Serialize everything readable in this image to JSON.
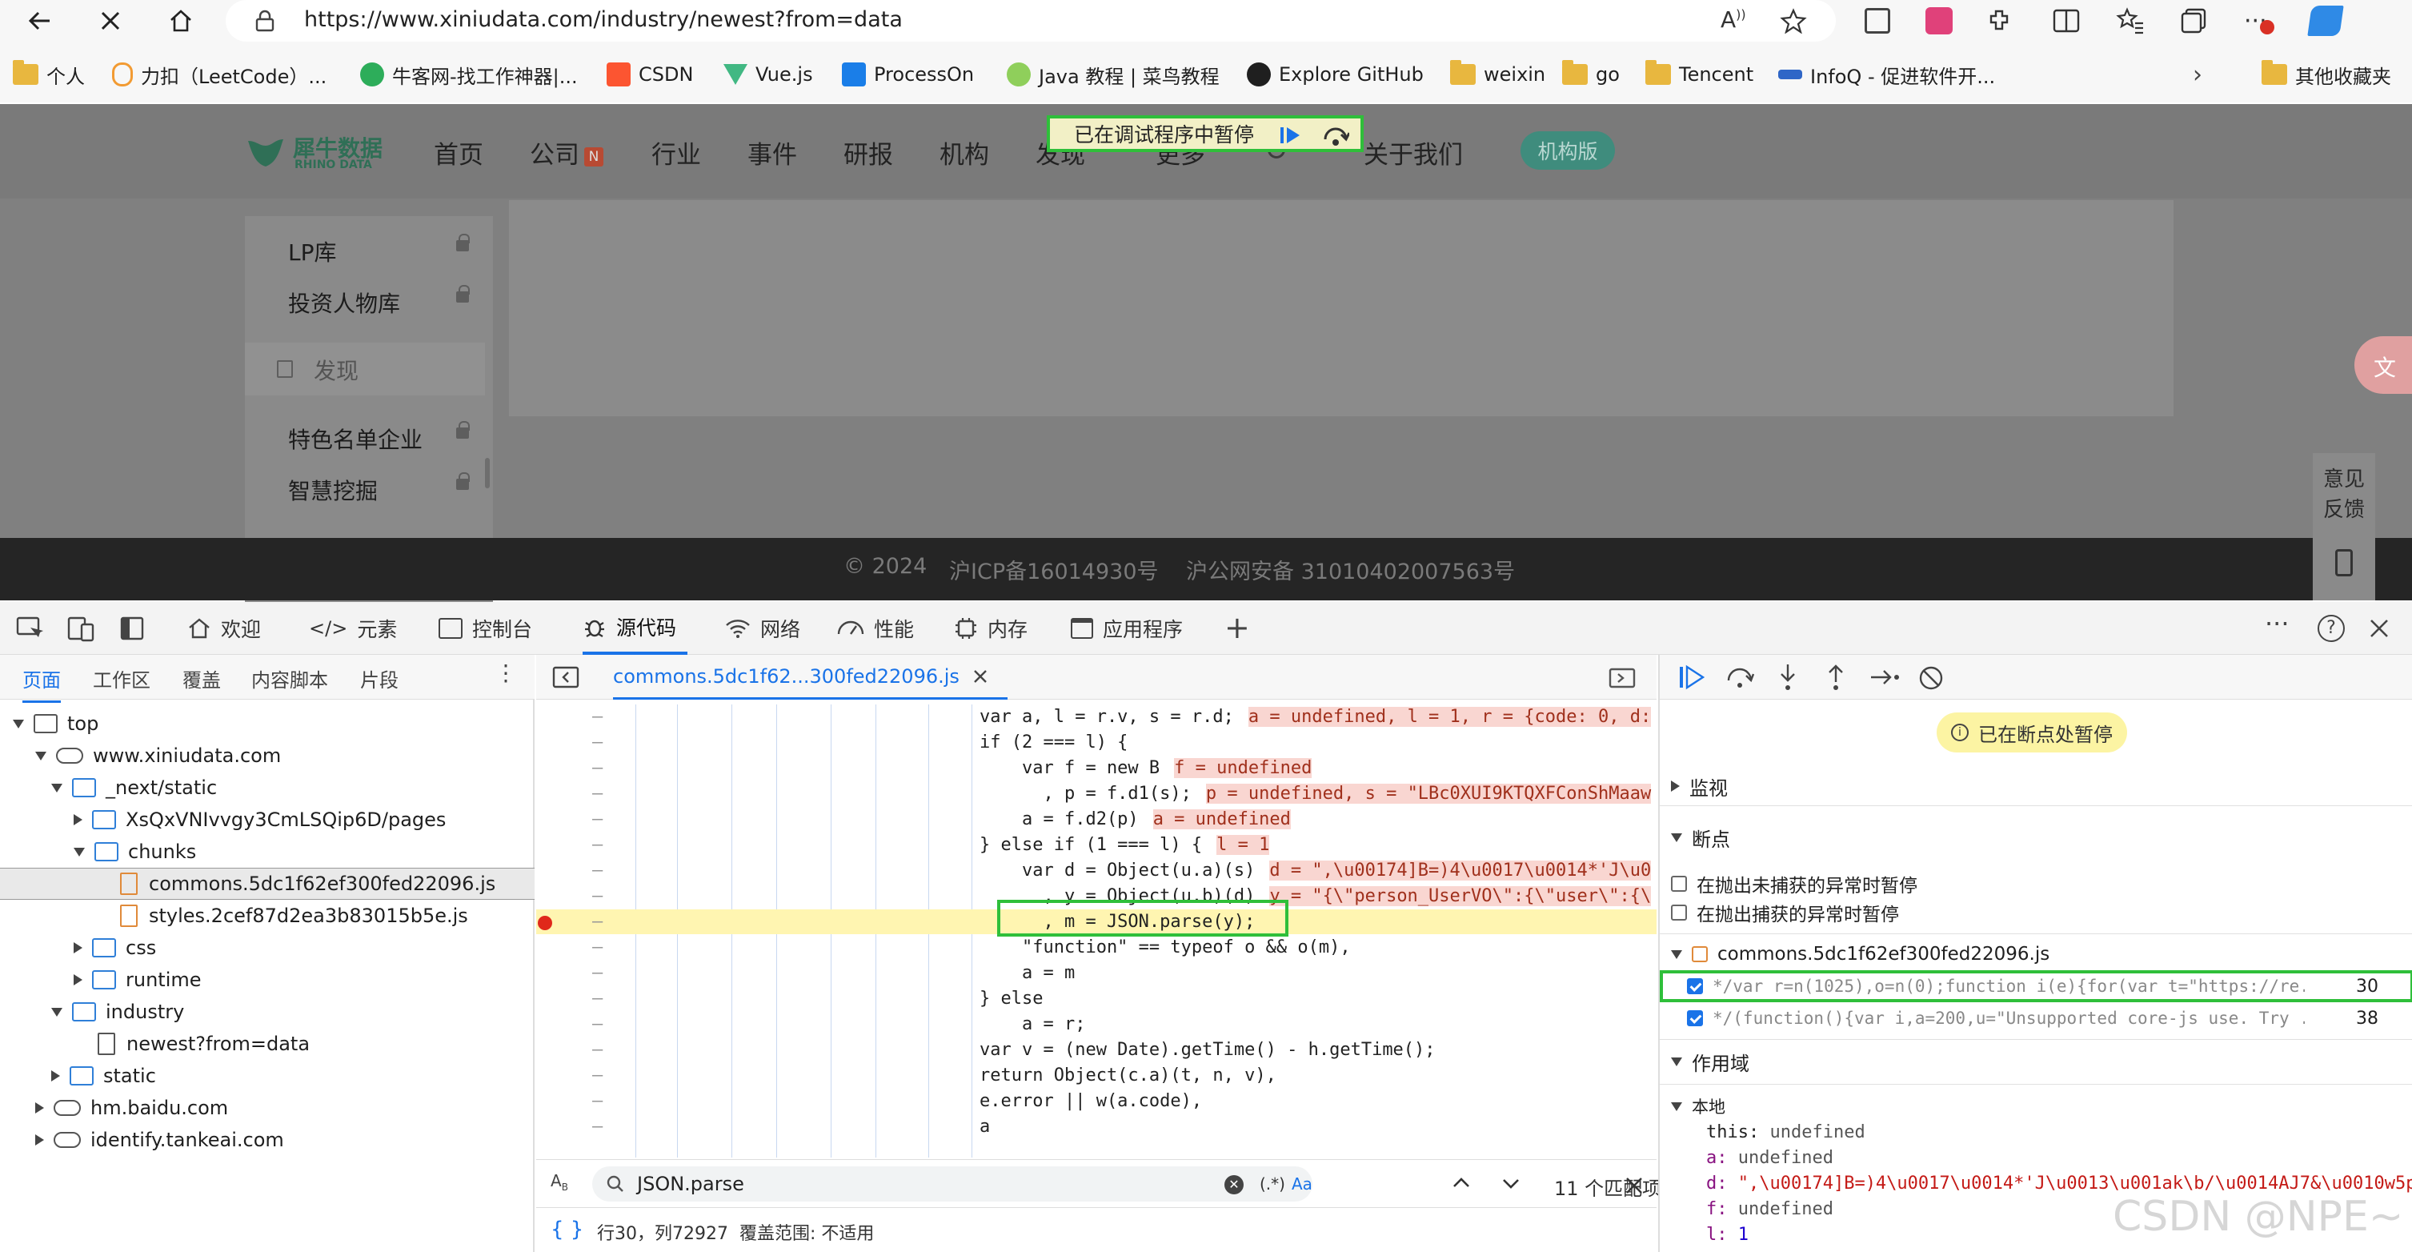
{
  "browser": {
    "url": "https://www.xiniudata.com/industry/newest?from=data",
    "bookmarks": [
      "个人",
      "力扣（LeetCode）...",
      "牛客网-找工作神器|...",
      "CSDN",
      "Vue.js",
      "ProcessOn",
      "Java 教程 | 菜鸟教程",
      "Explore GitHub",
      "weixin",
      "go",
      "Tencent",
      "InfoQ - 促进软件开..."
    ],
    "other_bookmarks": "其他收藏夹"
  },
  "site": {
    "logo_main": "犀牛数据",
    "logo_sub": "RHINO DATA",
    "nav": [
      "首页",
      "公司",
      "行业",
      "事件",
      "研报",
      "机构",
      "发现",
      "更多",
      "关于我们"
    ],
    "nav_badge": "N",
    "org_button": "机构版",
    "debug_banner": "已在调试程序中暂停",
    "menu": [
      "LP库",
      "投资人物库",
      "发现",
      "特色名单企业",
      "智慧挖掘"
    ],
    "footer": [
      "© 2024",
      "沪ICP备16014930号",
      "沪公网安备 31010402007563号"
    ],
    "feedback": [
      "意见",
      "反馈"
    ]
  },
  "devtools": {
    "tabs": [
      "欢迎",
      "元素",
      "控制台",
      "源代码",
      "网络",
      "性能",
      "内存",
      "应用程序"
    ],
    "left_tabs": [
      "页面",
      "工作区",
      "覆盖",
      "内容脚本",
      "片段"
    ],
    "tree": [
      "top",
      "www.xiniudata.com",
      "_next/static",
      "XsQxVNIvvgy3CmLSQip6D/pages",
      "chunks",
      "commons.5dc1f62ef300fed22096.js",
      "styles.2cef87d2ea3b83015b5e.js",
      "css",
      "runtime",
      "industry",
      "newest?from=data",
      "static",
      "hm.baidu.com",
      "identify.tankeai.com"
    ],
    "file_tab": "commons.5dc1f62...300fed22096.js",
    "code": [
      {
        "t": "var a, l = r.v, s = r.d;",
        "i": "a = undefined, l = 1, r = {code: 0, d:"
      },
      {
        "t": "if (2 === l) {",
        "i": ""
      },
      {
        "t": "    var f = new B",
        "i": "f = undefined"
      },
      {
        "t": "      , p = f.d1(s);",
        "i": "p = undefined, s = \"LBc0XUI9KTQXFConShMaaw"
      },
      {
        "t": "    a = f.d2(p)",
        "i": "a = undefined"
      },
      {
        "t": "} else if (1 === l) {",
        "i": "l = 1"
      },
      {
        "t": "    var d = Object(u.a)(s)",
        "i": "d = \",\\u00174]B=)4\\u0017\\u0014*'J\\u0"
      },
      {
        "t": "      , y = Object(u.b)(d)",
        "i": "y = \"{\\\"person_UserVO\\\":{\\\"user\\\":{\\"
      },
      {
        "t": "      , m = JSON.parse(y);",
        "i": ""
      },
      {
        "t": "    \"function\" == typeof o && o(m),",
        "i": ""
      },
      {
        "t": "    a = m",
        "i": ""
      },
      {
        "t": "} else",
        "i": ""
      },
      {
        "t": "    a = r;",
        "i": ""
      },
      {
        "t": "var v = (new Date).getTime() - h.getTime();",
        "i": ""
      },
      {
        "t": "return Object(c.a)(t, n, v),",
        "i": ""
      },
      {
        "t": "e.error || w(a.code),",
        "i": ""
      },
      {
        "t": "a",
        "i": ""
      }
    ],
    "search_value": "JSON.parse",
    "search_regex": "(.*)",
    "search_case": "Aa",
    "match_count": "11 个匹配项",
    "status_pos": "行30，列72927",
    "status_cov": "覆盖范围: 不适用",
    "paused": "已在断点处暂停",
    "sections": {
      "watch": "监视",
      "breakpoints": "断点",
      "scope": "作用域",
      "local": "本地"
    },
    "exc_uncaught": "在抛出未捕获的异常时暂停",
    "exc_caught": "在抛出捕获的异常时暂停",
    "bp_file": "commons.5dc1f62ef300fed22096.js",
    "bp_lines": [
      {
        "code": "*/var r=n(1025),o=n(0);function i(e){for(var t=\"https://re...",
        "line": "30"
      },
      {
        "code": "*/(function(){var i,a=200,u=\"Unsupported core-js use. Try ...",
        "line": "38"
      }
    ],
    "scope_vars": [
      {
        "k": "this:",
        "v": "undefined"
      },
      {
        "k": "a:",
        "v": "undefined"
      },
      {
        "k": "d:",
        "v": "\",\\u00174]B=)4\\u0017\\u0014*'J\\u0013\\u001ak\\b/\\u0014AJ7&\\u0010w5p"
      },
      {
        "k": "f:",
        "v": "undefined"
      },
      {
        "k": "l:",
        "v": "1"
      }
    ]
  },
  "watermark": "CSDN @NPE~"
}
